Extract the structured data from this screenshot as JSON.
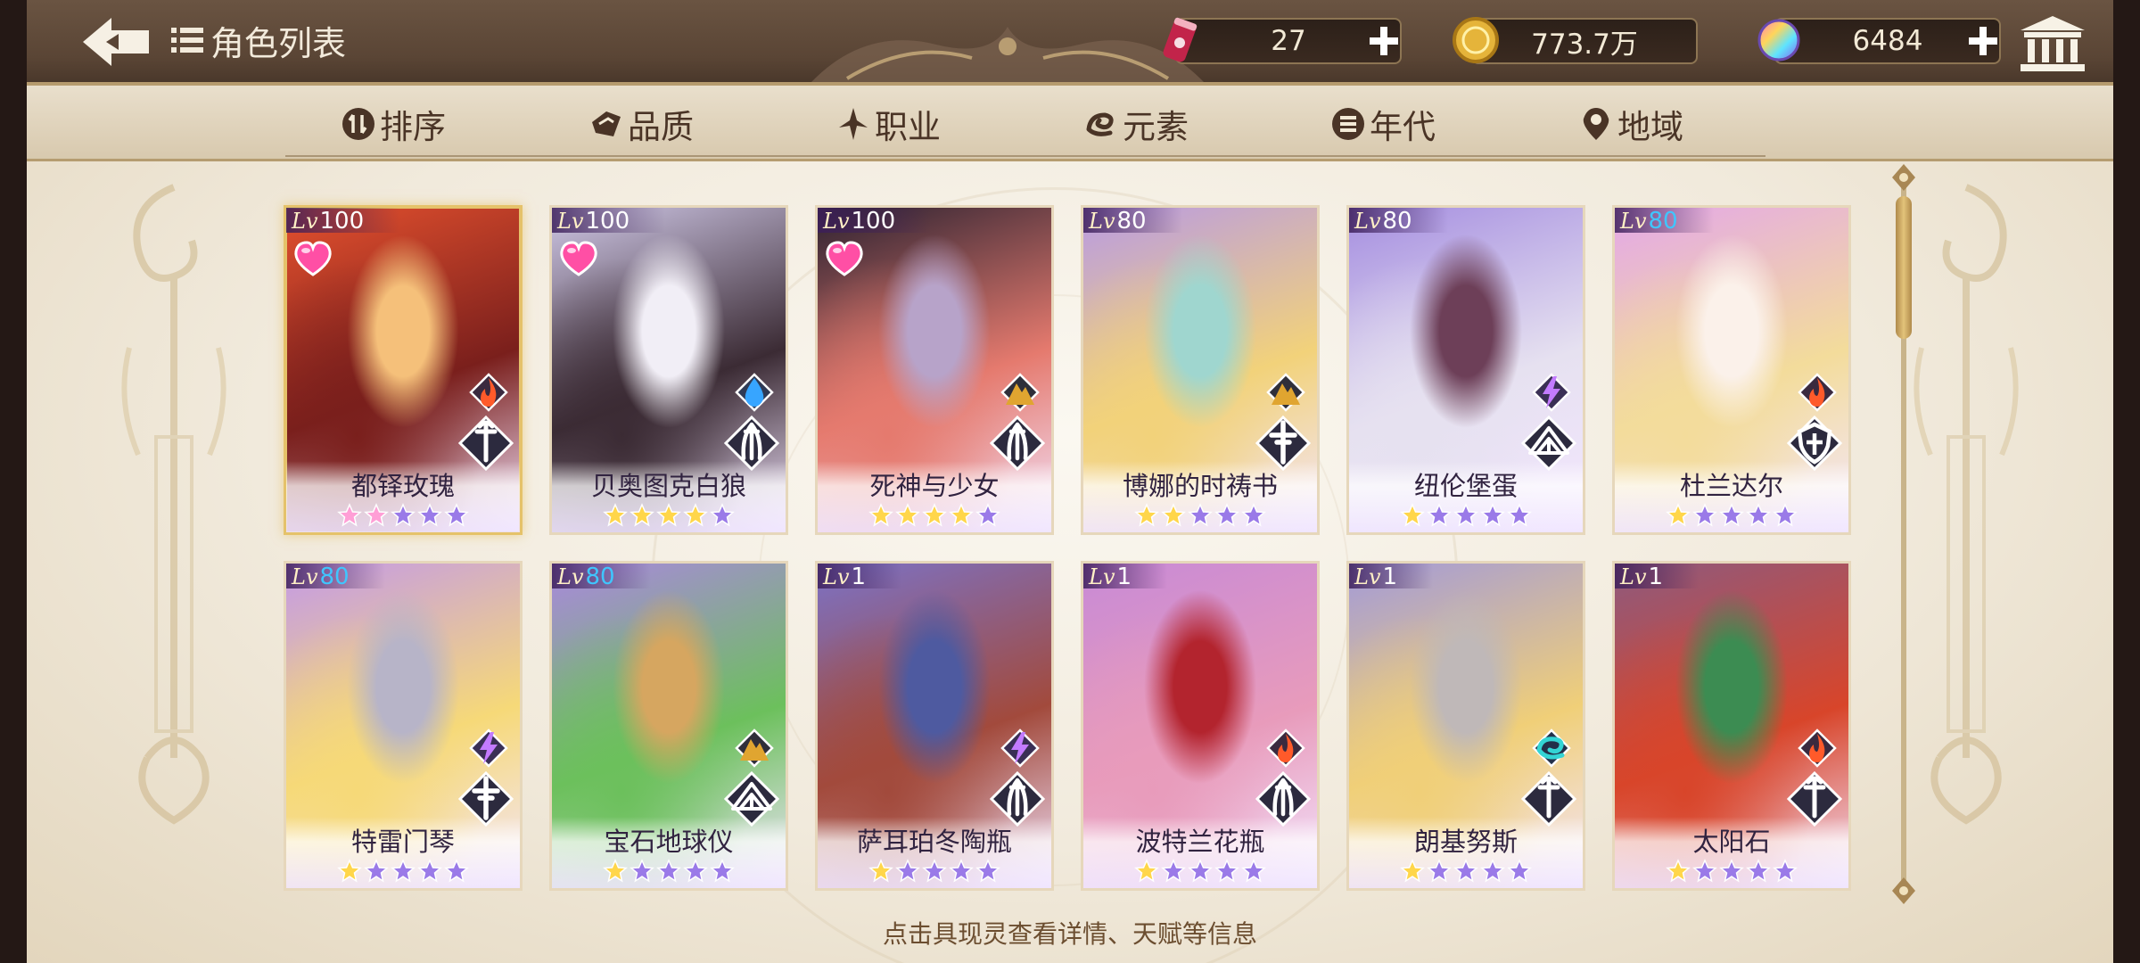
{
  "header": {
    "title": "角色列表",
    "resources": [
      {
        "name": "stamina",
        "value": "27",
        "color": "#c2244a"
      },
      {
        "name": "gold",
        "value": "773.7万",
        "color": "#e5b43a"
      },
      {
        "name": "gem",
        "value": "6484",
        "color": "#9f6cf0"
      }
    ]
  },
  "filters": [
    {
      "label": "排序",
      "icon": "sort-icon"
    },
    {
      "label": "品质",
      "icon": "quality-icon"
    },
    {
      "label": "职业",
      "icon": "class-icon"
    },
    {
      "label": "元素",
      "icon": "element-icon"
    },
    {
      "label": "年代",
      "icon": "era-icon"
    },
    {
      "label": "地域",
      "icon": "location-icon"
    }
  ],
  "cards": [
    {
      "name": "都铎玫瑰",
      "lv": "100",
      "lv_color": "white",
      "favorite": true,
      "element": "fire",
      "job": "sword",
      "stars_filled": 2,
      "star_kind": "pink",
      "selected": true,
      "palette": [
        "#e3502e",
        "#7a1f1c",
        "#f5c07a"
      ]
    },
    {
      "name": "贝奥图克白狼",
      "lv": "100",
      "lv_color": "white",
      "favorite": true,
      "element": "water",
      "job": "claw",
      "stars_filled": 4,
      "star_kind": "gold",
      "selected": false,
      "palette": [
        "#cfc7e6",
        "#3b2b34",
        "#f1eef6"
      ]
    },
    {
      "name": "死神与少女",
      "lv": "100",
      "lv_color": "white",
      "favorite": true,
      "element": "earth",
      "job": "claw",
      "stars_filled": 4,
      "star_kind": "gold",
      "selected": false,
      "palette": [
        "#2c2231",
        "#e57a6e",
        "#b7a3c9"
      ]
    },
    {
      "name": "博娜的时祷书",
      "lv": "80",
      "lv_color": "white",
      "favorite": false,
      "element": "earth",
      "job": "cross",
      "stars_filled": 2,
      "star_kind": "gold",
      "selected": false,
      "palette": [
        "#b99be2",
        "#f2d27a",
        "#9fd6cf"
      ]
    },
    {
      "name": "纽伦堡蛋",
      "lv": "80",
      "lv_color": "white",
      "favorite": false,
      "element": "thunder",
      "job": "book",
      "stars_filled": 1,
      "star_kind": "gold",
      "selected": false,
      "palette": [
        "#a58ee0",
        "#e6e1f0",
        "#6d3f58"
      ]
    },
    {
      "name": "杜兰达尔",
      "lv": "80",
      "lv_color": "blue",
      "favorite": false,
      "element": "fire",
      "job": "shield",
      "stars_filled": 1,
      "star_kind": "gold",
      "selected": false,
      "palette": [
        "#e4a8e8",
        "#f3dc9b",
        "#fbf1ea"
      ]
    },
    {
      "name": "特雷门琴",
      "lv": "80",
      "lv_color": "blue",
      "favorite": false,
      "element": "thunder",
      "job": "cross",
      "stars_filled": 1,
      "star_kind": "gold",
      "selected": false,
      "palette": [
        "#c49ae6",
        "#f6d978",
        "#b7b4c8"
      ]
    },
    {
      "name": "宝石地球仪",
      "lv": "80",
      "lv_color": "blue",
      "favorite": false,
      "element": "earth",
      "job": "book",
      "stars_filled": 1,
      "star_kind": "gold",
      "selected": false,
      "palette": [
        "#aa88de",
        "#6cc05c",
        "#d6a660"
      ]
    },
    {
      "name": "萨耳珀冬陶瓶",
      "lv": "1",
      "lv_color": "white",
      "favorite": false,
      "element": "thunder",
      "job": "claw",
      "stars_filled": 1,
      "star_kind": "gold",
      "selected": false,
      "palette": [
        "#7c72c6",
        "#a24a3c",
        "#4e5aa0"
      ]
    },
    {
      "name": "波特兰花瓶",
      "lv": "1",
      "lv_color": "white",
      "favorite": false,
      "element": "fire",
      "job": "claw",
      "stars_filled": 1,
      "star_kind": "gold",
      "selected": false,
      "palette": [
        "#c88ad6",
        "#e89bbb",
        "#b3242e"
      ]
    },
    {
      "name": "朗基努斯",
      "lv": "1",
      "lv_color": "white",
      "favorite": false,
      "element": "wind",
      "job": "sword",
      "stars_filled": 1,
      "star_kind": "gold",
      "selected": false,
      "palette": [
        "#a39ad8",
        "#f0cf78",
        "#bfb8b8"
      ]
    },
    {
      "name": "太阳石",
      "lv": "1",
      "lv_color": "white",
      "favorite": false,
      "element": "fire",
      "job": "sword",
      "stars_filled": 1,
      "star_kind": "gold",
      "selected": false,
      "palette": [
        "#8e5a7e",
        "#d8452a",
        "#3c8c52"
      ]
    }
  ],
  "hint": "点击具现灵查看详情、天赋等信息",
  "lv_prefix": "Lv"
}
